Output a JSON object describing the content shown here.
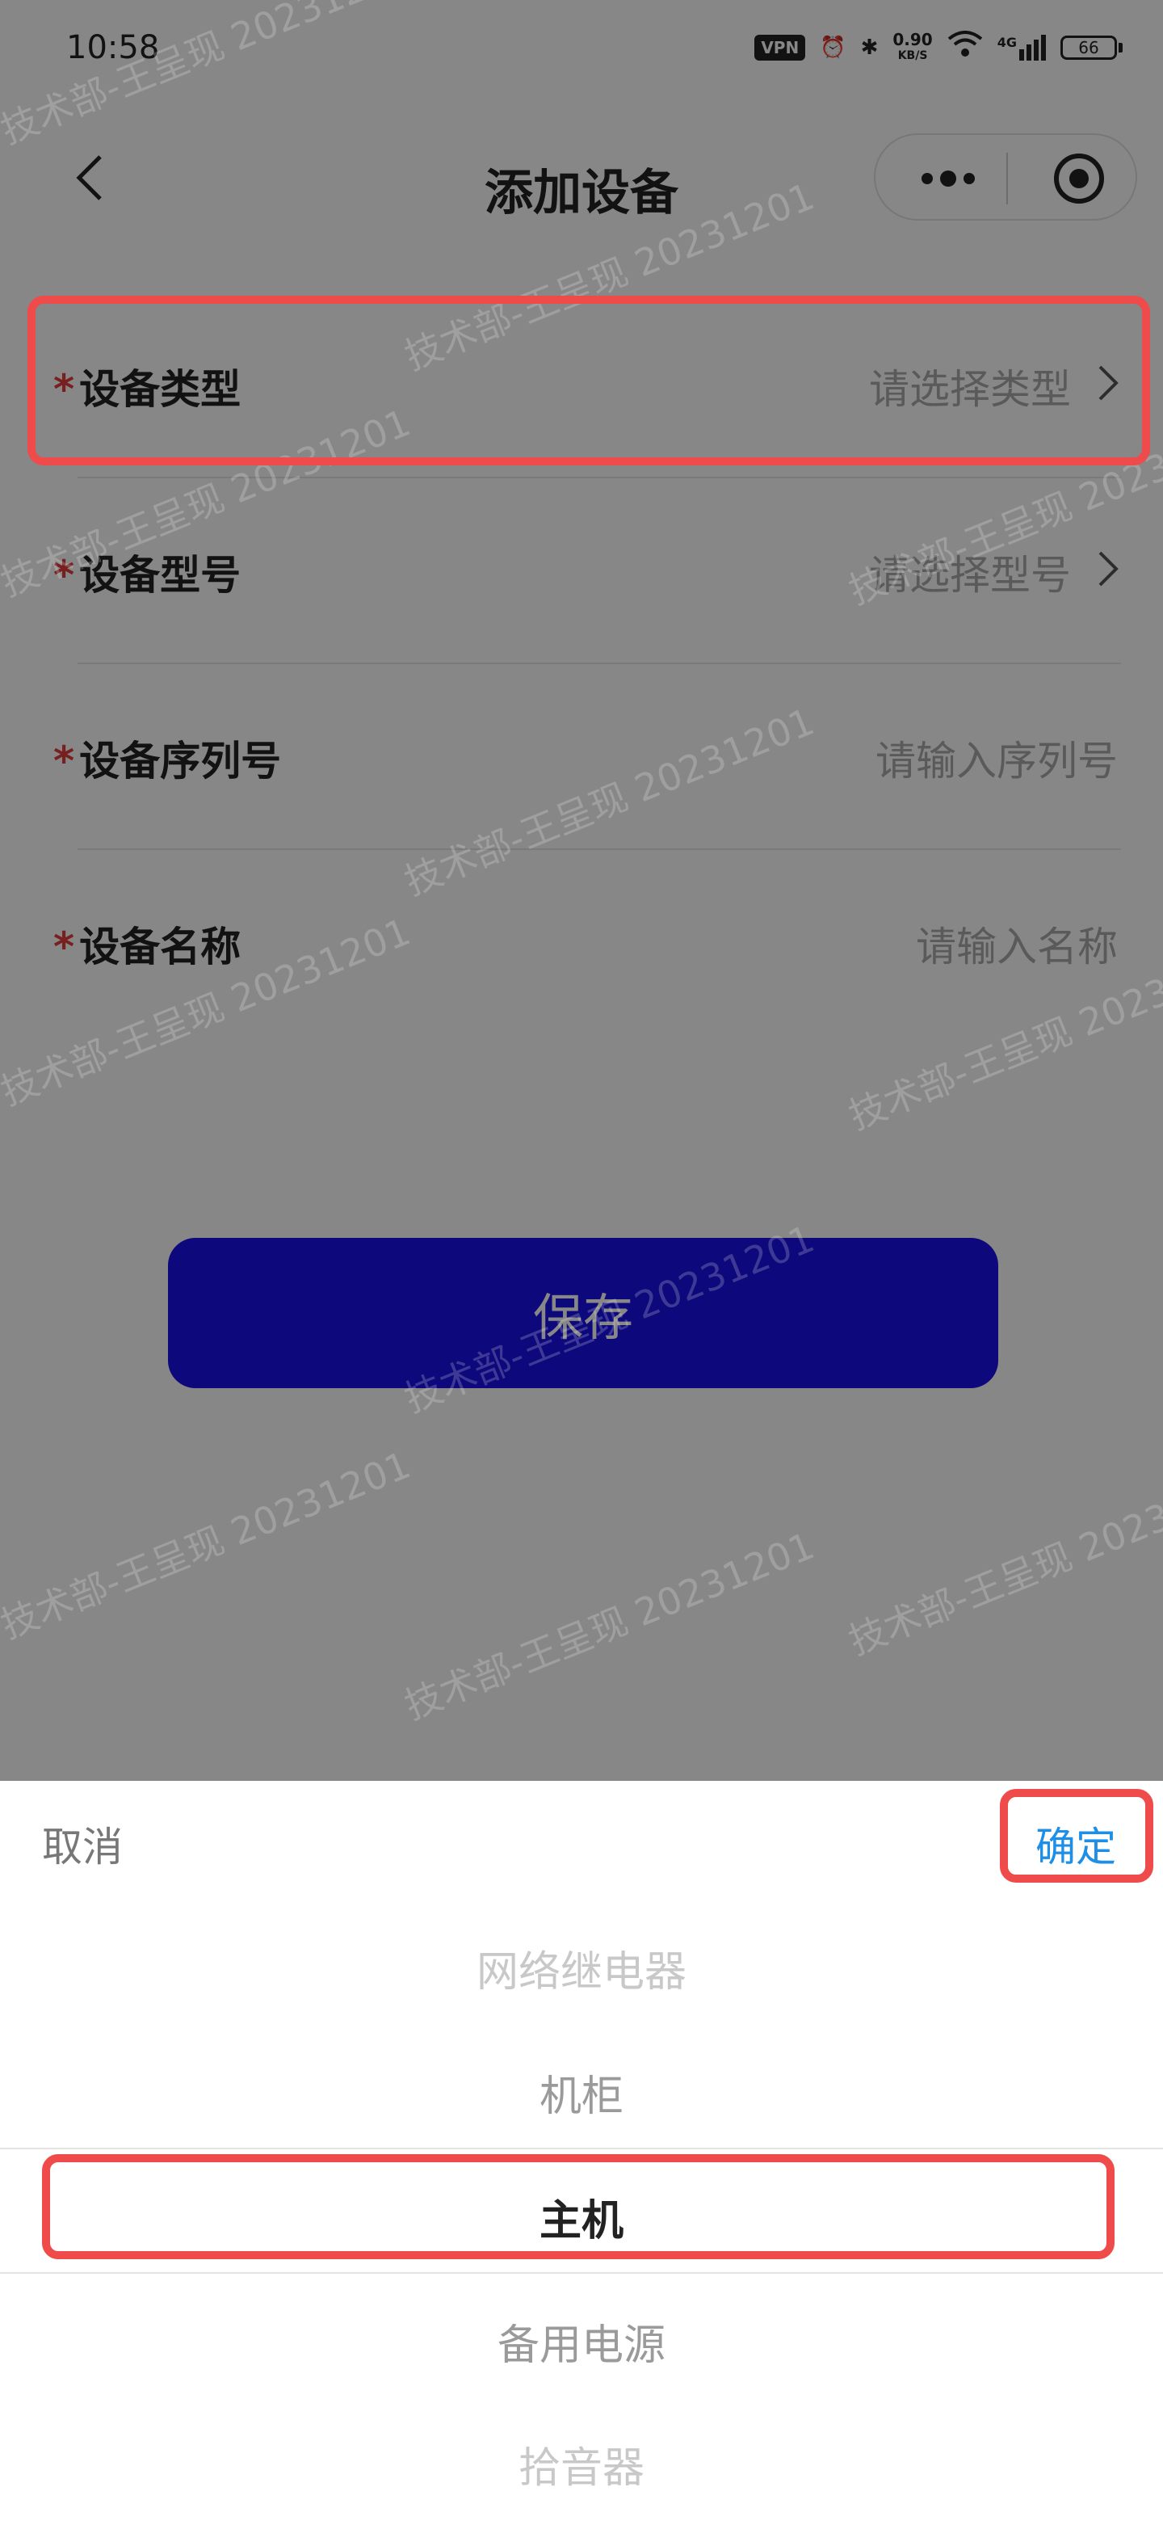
{
  "status_bar": {
    "time": "10:58",
    "vpn": "VPN",
    "speed_value": "0.90",
    "speed_unit": "KB/S",
    "network": "4G",
    "battery": "66"
  },
  "nav": {
    "title": "添加设备"
  },
  "form": {
    "fields": [
      {
        "label": "设备类型",
        "value": "请选择类型"
      },
      {
        "label": "设备型号",
        "value": "请选择型号"
      },
      {
        "label": "设备序列号",
        "value": "请输入序列号"
      },
      {
        "label": "设备名称",
        "value": "请输入名称"
      }
    ],
    "required_mark": "*"
  },
  "save_label": "保存",
  "watermark": "技术部-王呈现 20231201",
  "picker": {
    "cancel": "取消",
    "confirm": "确定",
    "options": [
      "网络继电器",
      "机柜",
      "主机",
      "备用电源",
      "拾音器"
    ],
    "selected": "主机"
  },
  "colors": {
    "accent": "#1e8fe6",
    "save_button": "#1a10e8",
    "required": "#e23b3b",
    "highlight": "#ef4b4b"
  }
}
